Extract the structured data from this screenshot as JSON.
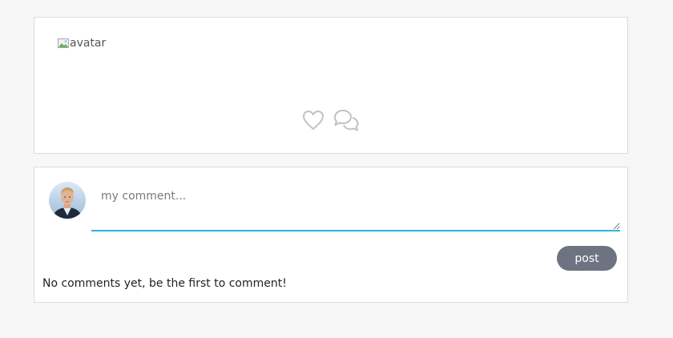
{
  "post": {
    "image_alt": "avatar",
    "like_icon": "heart-outline-icon",
    "comments_icon": "speech-bubbles-icon"
  },
  "comments": {
    "user_avatar_icon": "user-avatar-photo",
    "input": {
      "placeholder": "my comment...",
      "value": ""
    },
    "post_button_label": "post",
    "empty_message": "No comments yet, be the first to comment!"
  },
  "colors": {
    "page_background": "#f7f7f7",
    "card_border": "#dcdcdc",
    "input_underline": "#29b6d8",
    "button_background": "#6d7380",
    "icon_gray": "#c2c2c2"
  }
}
